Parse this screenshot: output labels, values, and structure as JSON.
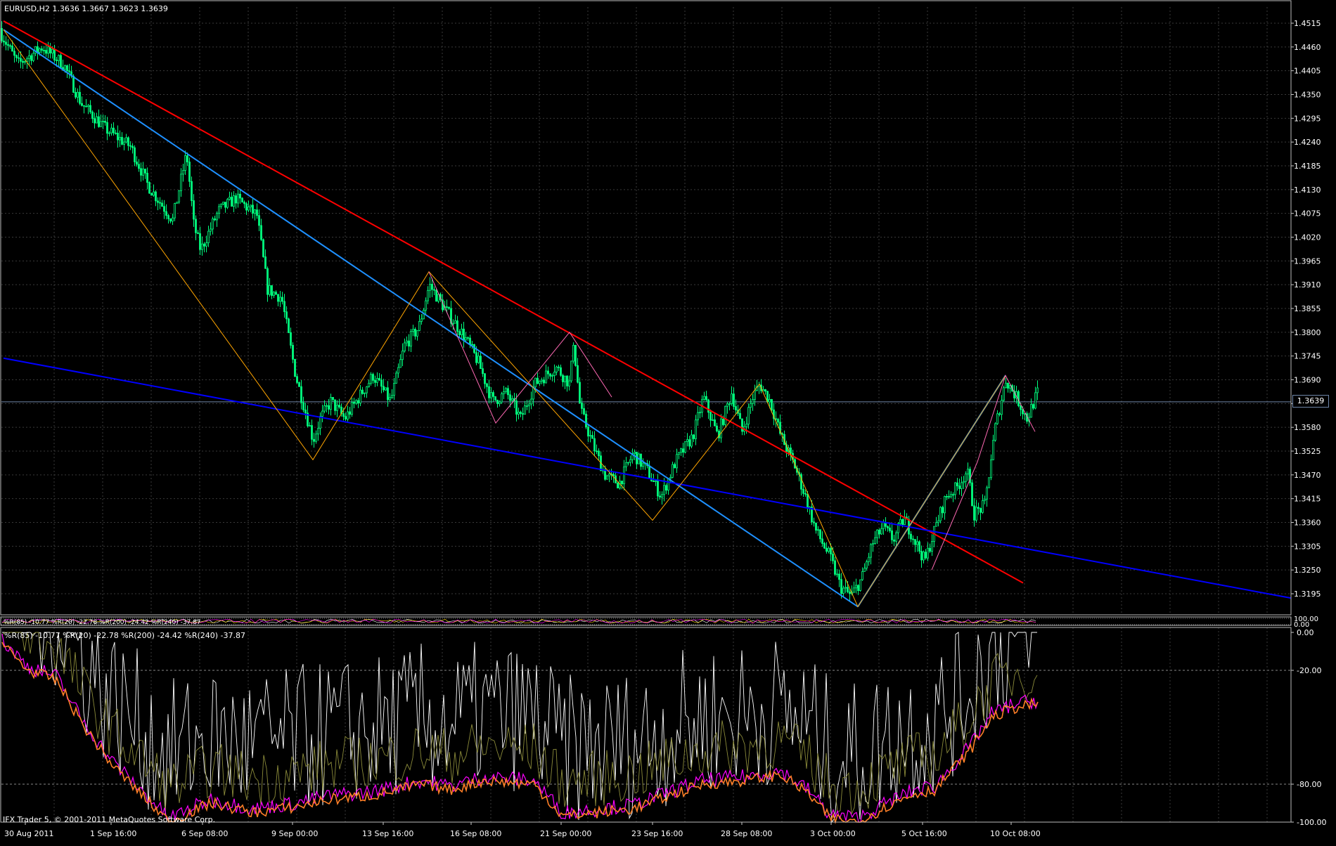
{
  "main_chart": {
    "title": "EURUSD,H2  1.3636 1.3667 1.3623 1.3639",
    "current_price_label": "1.3639",
    "price_ticks": [
      "1.4515",
      "1.4460",
      "1.4405",
      "1.4350",
      "1.4295",
      "1.4240",
      "1.4185",
      "1.4130",
      "1.4075",
      "1.4020",
      "1.3965",
      "1.3910",
      "1.3855",
      "1.3800",
      "1.3745",
      "1.3690",
      "1.3635",
      "1.3580",
      "1.3525",
      "1.3470",
      "1.3415",
      "1.3360",
      "1.3305",
      "1.3250",
      "1.3195"
    ],
    "strip_ticks": [
      "100.00",
      "0.00"
    ]
  },
  "indicator": {
    "title": "%R(85) -10.77 %R(20) -22.78 %R(200) -24.42 %R(240) -37.87",
    "strip_title": "%R(85) -10.77 %R(20) -22.78 %R(200) -24.42 %R(240) -37.87",
    "ticks": [
      "0.00",
      "-20.00",
      "-80.00",
      "-100.00"
    ]
  },
  "time_axis": [
    "30 Aug 2011",
    "1 Sep 16:00",
    "6 Sep 08:00",
    "9 Sep 00:00",
    "13 Sep 16:00",
    "16 Sep 08:00",
    "21 Sep 00:00",
    "23 Sep 16:00",
    "28 Sep 08:00",
    "3 Oct 00:00",
    "5 Oct 16:00",
    "10 Oct 08:00"
  ],
  "footer": {
    "copyright": "IFX Trader 5, © 2001-2011 MetaQuotes Software Corp."
  },
  "colors": {
    "background": "#000000",
    "grid": "#3a3a3a",
    "candle": "#00ff7f",
    "red_line": "#ff0000",
    "light_blue_line": "#1e90ff",
    "blue_line": "#0000ff",
    "zigzag": "#ffa500",
    "pink": "#ff69b4",
    "wr85": "#ffffff",
    "wr20": "#8b8b3a",
    "wr200": "#ff00ff",
    "wr240": "#ff7f27"
  },
  "chart_data": {
    "type": "line",
    "title": "EURUSD,H2",
    "ylim": [
      1.3175,
      1.453
    ],
    "x": [
      "30 Aug 2011",
      "1 Sep 16:00",
      "6 Sep 08:00",
      "9 Sep 00:00",
      "13 Sep 16:00",
      "16 Sep 08:00",
      "21 Sep 00:00",
      "23 Sep 16:00",
      "28 Sep 08:00",
      "3 Oct 00:00",
      "5 Oct 16:00",
      "10 Oct 08:00"
    ],
    "series": [
      {
        "name": "EURUSD",
        "values": [
          1.45,
          1.429,
          1.405,
          1.356,
          1.379,
          1.372,
          1.368,
          1.35,
          1.365,
          1.324,
          1.34,
          1.3639
        ]
      }
    ]
  }
}
